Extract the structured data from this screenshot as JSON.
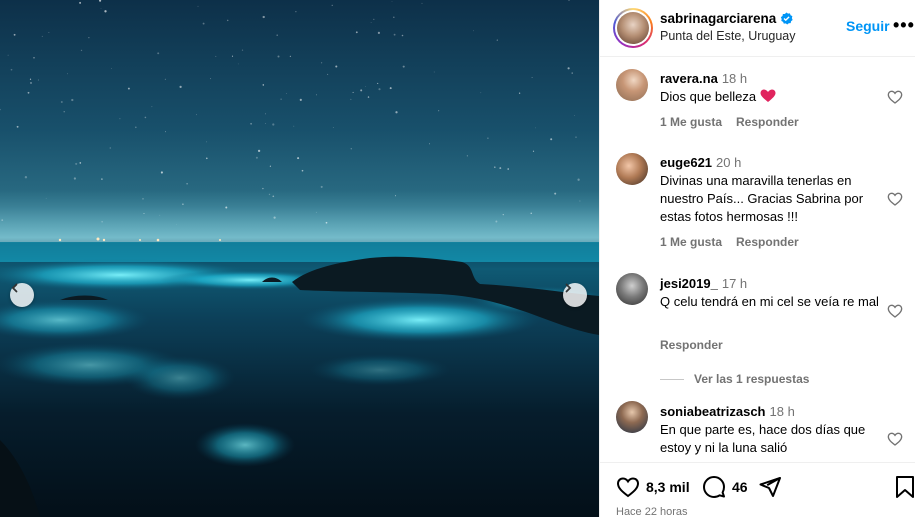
{
  "post": {
    "username": "sabrinagarciarena",
    "location": "Punta del Este, Uruguay",
    "follow_label": "Seguir",
    "more_label": "•••",
    "prev_arrow": "‹",
    "next_arrow": "›"
  },
  "comments": [
    {
      "user": "ravera.na",
      "time": "18 h",
      "text": "Dios que belleza",
      "has_heart_emoji": true,
      "like_label": "1 Me gusta",
      "reply_label": "Responder"
    },
    {
      "user": "euge621",
      "time": "20 h",
      "text": "Divinas una maravilla tenerlas en nuestro País... Gracias Sabrina por estas fotos hermosas !!!",
      "like_label": "1 Me gusta",
      "reply_label": "Responder"
    },
    {
      "user": "jesi2019_",
      "time": "17 h",
      "text": "Q celu tendrá en mi cel se veía re mal",
      "reply_label": "Responder",
      "view_replies": "Ver las 1 respuestas"
    },
    {
      "user": "soniabeatrizasch",
      "time": "18 h",
      "text": "En que parte es, hace dos días que estoy y ni la luna salió"
    }
  ],
  "stats": {
    "likes": "8,3 mil",
    "comments": "46",
    "time_ago": "Hace 22 horas"
  },
  "colors": {
    "accent": "#0095f6",
    "verified": "#0095f6",
    "heart_emoji": "#e0245e"
  }
}
